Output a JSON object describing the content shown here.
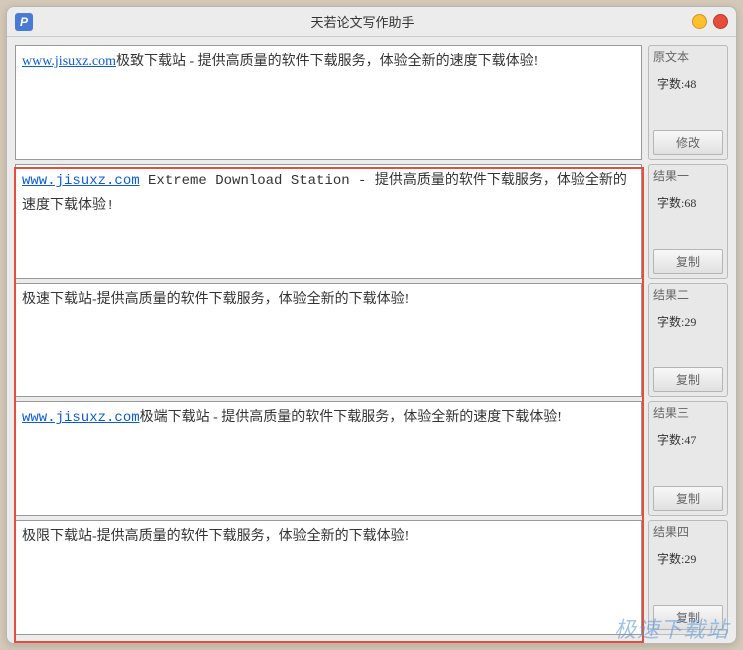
{
  "app": {
    "icon_letter": "P",
    "title": "天若论文写作助手"
  },
  "panels": [
    {
      "link": "www.jisuxz.com",
      "link_style": "normal",
      "text_after": "极致下载站 - 提供高质量的软件下载服务，体验全新的速度下载体验!"
    },
    {
      "link": "www.jisuxz.com",
      "link_style": "mono",
      "text_after": " Extreme Download Station  - 提供高质量的软件下载服务，体验全新的速度下载体验!"
    },
    {
      "link": "",
      "link_style": "normal",
      "text_after": "极速下载站-提供高质量的软件下载服务，体验全新的下载体验!"
    },
    {
      "link": "www.jisuxz.com",
      "link_style": "mono",
      "text_after": "极端下载站 - 提供高质量的软件下载服务，体验全新的速度下载体验!"
    },
    {
      "link": "",
      "link_style": "normal",
      "text_after": "极限下载站-提供高质量的软件下载服务，体验全新的下载体验!"
    }
  ],
  "sidebar": [
    {
      "title": "原文本",
      "count_label": "字数:48",
      "button": "修改"
    },
    {
      "title": "结果一",
      "count_label": "字数:68",
      "button": "复制"
    },
    {
      "title": "结果二",
      "count_label": "字数:29",
      "button": "复制"
    },
    {
      "title": "结果三",
      "count_label": "字数:47",
      "button": "复制"
    },
    {
      "title": "结果四",
      "count_label": "字数:29",
      "button": "复制"
    }
  ],
  "watermark": "极速下载站"
}
